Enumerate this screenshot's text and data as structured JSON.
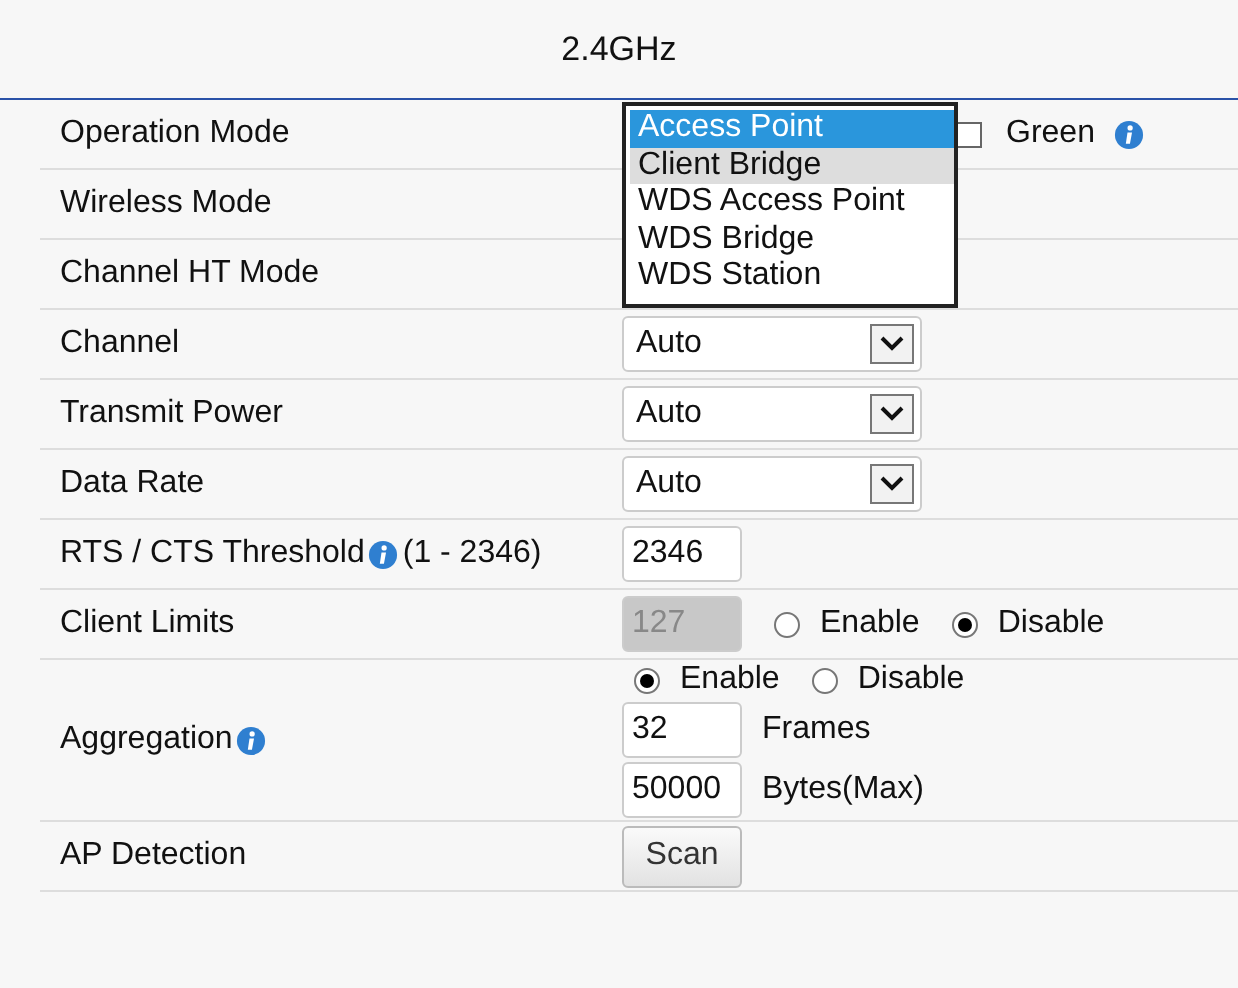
{
  "band_title": "2.4GHz",
  "rows": [
    {
      "label": "Operation Mode",
      "lines": [
        [
          {
            "kind": "listbox",
            "options": [
              {
                "label": "Access Point",
                "selected": true,
                "hovered": false
              },
              {
                "label": "Client Bridge",
                "selected": false,
                "hovered": true
              },
              {
                "label": "WDS Access Point",
                "selected": false,
                "hovered": false
              },
              {
                "label": "WDS Bridge",
                "selected": false,
                "hovered": false
              },
              {
                "label": "WDS Station",
                "selected": false,
                "hovered": false
              }
            ]
          },
          {
            "kind": "checkbox",
            "label": "Green",
            "checked": false
          },
          {
            "kind": "info"
          }
        ]
      ]
    },
    {
      "label": "Wireless Mode",
      "lines": []
    },
    {
      "label": "Channel HT Mode",
      "lines": []
    },
    {
      "label": "Channel",
      "lines": [
        [
          {
            "kind": "select",
            "value": "Auto"
          }
        ]
      ]
    },
    {
      "label": "Transmit Power",
      "lines": [
        [
          {
            "kind": "select",
            "value": "Auto"
          }
        ]
      ]
    },
    {
      "label": "Data Rate",
      "lines": [
        [
          {
            "kind": "select",
            "value": "Auto"
          }
        ]
      ]
    },
    {
      "label": "RTS / CTS Threshold",
      "info": true,
      "note": "(1 - 2346)",
      "lines": [
        [
          {
            "kind": "input",
            "value": "2346",
            "disabled": false
          }
        ]
      ]
    },
    {
      "label": "Client Limits",
      "lines": [
        [
          {
            "kind": "input",
            "value": "127",
            "disabled": true
          },
          {
            "kind": "radio",
            "label": "Enable",
            "selected": false
          },
          {
            "kind": "radio",
            "label": "Disable",
            "selected": true
          }
        ]
      ]
    },
    {
      "label": "Aggregation",
      "info": true,
      "lines": [
        [
          {
            "kind": "radio",
            "label": "Enable",
            "selected": true
          },
          {
            "kind": "radio",
            "label": "Disable",
            "selected": false
          }
        ],
        [
          {
            "kind": "input",
            "value": "32",
            "disabled": false
          },
          {
            "kind": "text",
            "text": "Frames"
          }
        ],
        [
          {
            "kind": "input",
            "value": "50000",
            "disabled": false
          },
          {
            "kind": "text",
            "text": "Bytes(Max)"
          }
        ]
      ]
    },
    {
      "label": "AP Detection",
      "lines": [
        [
          {
            "kind": "button",
            "label": "Scan"
          }
        ]
      ]
    }
  ]
}
